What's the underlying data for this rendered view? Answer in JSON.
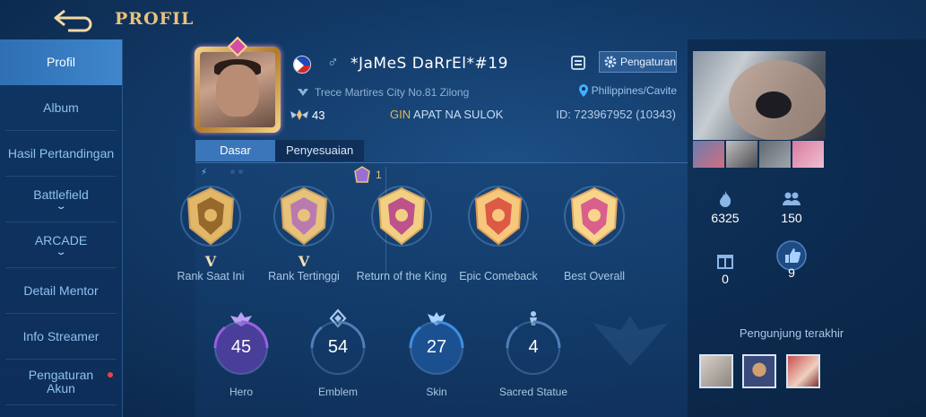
{
  "header": {
    "title": "PROFIL"
  },
  "sidebar": {
    "items": [
      {
        "label": "Profil",
        "active": true
      },
      {
        "label": "Album"
      },
      {
        "label": "Hasil Pertandingan"
      },
      {
        "label": "Battlefield",
        "expandable": true
      },
      {
        "label": "ARCADE",
        "expandable": true
      },
      {
        "label": "Detail Mentor"
      },
      {
        "label": "Info Streamer"
      },
      {
        "label": "Pengaturan Akun",
        "notification": true
      }
    ]
  },
  "profile": {
    "name": "*JaMeS DaRrEl*#19",
    "location": "Trece Martires City No.81 Zilong",
    "region": "Philippines/Cavite",
    "level": "43",
    "squad_tag": "GIN",
    "squad_name": "APAT NA SULOK",
    "id": "ID: 723967952 (10343)",
    "settings_label": "Pengaturan"
  },
  "tabs": [
    {
      "label": "Dasar",
      "active": true
    },
    {
      "label": "Penyesuaian"
    }
  ],
  "rank": {
    "star_count": "1",
    "medals": [
      {
        "label": "Rank Saat Ini",
        "tier": "V"
      },
      {
        "label": "Rank Tertinggi",
        "tier": "V"
      },
      {
        "label": "Return of the King"
      },
      {
        "label": "Epic Comeback"
      },
      {
        "label": "Best Overall"
      }
    ]
  },
  "stats": [
    {
      "label": "Hero",
      "value": "45",
      "color": "#9b5fe0"
    },
    {
      "label": "Emblem",
      "value": "54",
      "color": "#4e7fb8"
    },
    {
      "label": "Skin",
      "value": "27",
      "color": "#3e8fe0"
    },
    {
      "label": "Sacred Statue",
      "value": "4",
      "color": "#4e7fb8"
    }
  ],
  "side_stats": {
    "popularity": "6325",
    "followers": "150",
    "gifts": "0",
    "likes": "9"
  },
  "visitors": {
    "title": "Pengunjung terakhir"
  },
  "icons": {
    "back": "back-arrow-icon",
    "copy": "copy-icon",
    "settings": "gear-icon",
    "location": "location-pin-icon",
    "popularity": "flame-icon",
    "followers": "people-icon",
    "gifts": "gift-icon",
    "likes": "thumbs-up-icon"
  },
  "colors": {
    "accent_gold": "#e9c27a",
    "tab_active": "#3a76b9",
    "background": "#123a68"
  }
}
